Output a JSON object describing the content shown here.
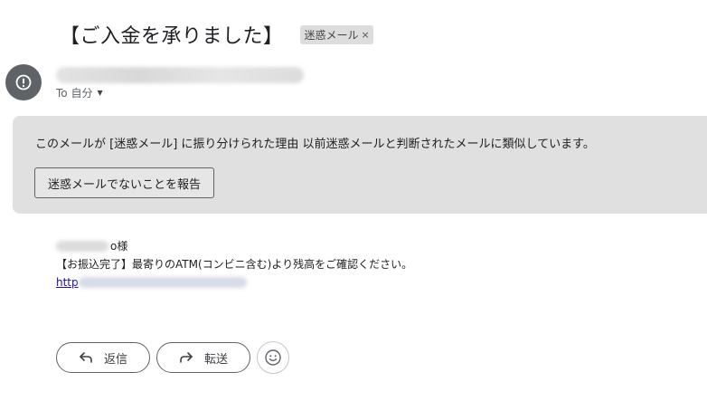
{
  "email": {
    "subject": "【ご入金を承りました】",
    "label": "迷惑メール",
    "label_remove": "×",
    "recipient": "To 自分"
  },
  "spam_warning": {
    "message": "このメールが [迷惑メール] に振り分けられた理由 以前迷惑メールと判断されたメールに類似しています。",
    "report_button": "迷惑メールでないことを報告"
  },
  "body": {
    "greeting_suffix": "o様",
    "line2": "【お振込完了】最寄りのATM(コンビニ含む)より残高をご確認ください。",
    "link_prefix": "http"
  },
  "actions": {
    "reply": "返信",
    "forward": "転送"
  },
  "icons": {
    "avatar": "alert-circle-icon",
    "reply": "reply-arrow-icon",
    "forward": "forward-arrow-icon",
    "emoji": "smiley-icon"
  },
  "colors": {
    "link": "#1a0dab",
    "warning_bg": "#e0e0e0",
    "avatar_bg": "#5f6368"
  }
}
